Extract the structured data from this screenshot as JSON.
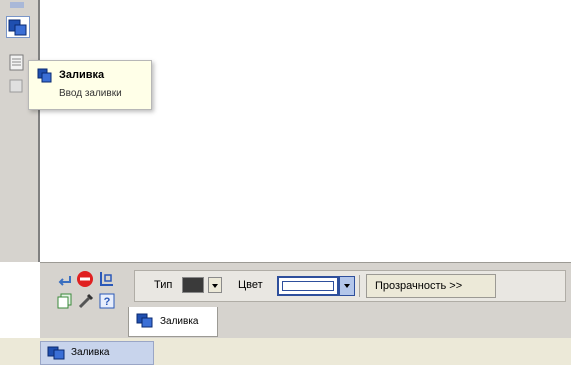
{
  "tooltip": {
    "title": "Заливка",
    "subtitle": "Ввод заливки",
    "icon": "fill-icon"
  },
  "properties": {
    "type_label": "Тип",
    "color_label": "Цвет",
    "transparency_button": "Прозрачность  >>",
    "type_color": "#3a3a3a",
    "accent_color": "#2e4f9c"
  },
  "tabs": {
    "object_tab_label": "Заливка",
    "bottom_tab_label": "Заливка"
  },
  "toolbar_icons": [
    "enter-icon",
    "stop-icon",
    "snap-icon",
    "copy-icon",
    "pipette-icon",
    "help-icon"
  ]
}
